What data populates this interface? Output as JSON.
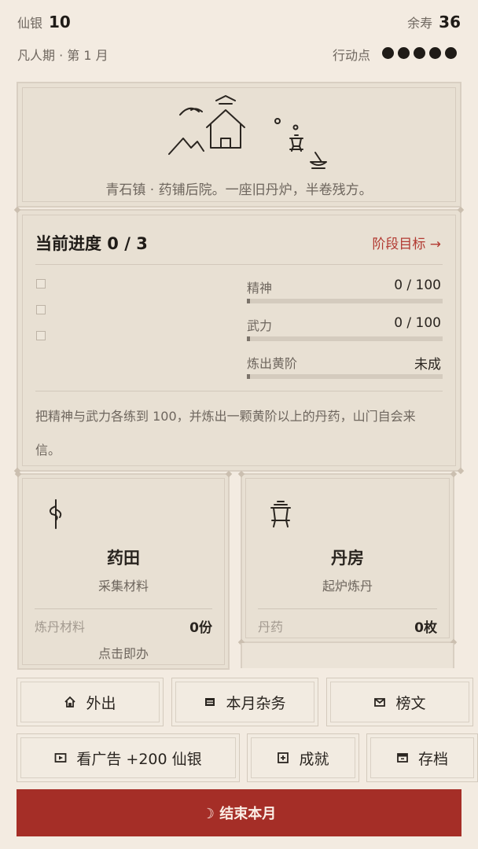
{
  "header": {
    "silver_label": "仙银",
    "silver_value": "10",
    "lifespan_label": "余寿",
    "lifespan_value": "36",
    "stage_text": "凡人期 · 第 1 月",
    "action_label": "行动点",
    "action_points": 5
  },
  "scene": {
    "caption": "青石镇 · 药铺后院。一座旧丹炉，半卷残方。"
  },
  "progress": {
    "title": "当前进度 0 / 3",
    "goal_link": "阶段目标 →",
    "stats": [
      {
        "label": "精神",
        "value": "0 / 100",
        "fraction": 0
      },
      {
        "label": "武力",
        "value": "0 / 100",
        "fraction": 0
      },
      {
        "label": "炼出黄阶",
        "value": "未成",
        "fraction": 0
      }
    ],
    "description": "把精神与武力各练到 100，并炼出一颗黄阶以上的丹药，山门自会来信。"
  },
  "cards": {
    "herb_field": {
      "title": "药田",
      "subtitle": "采集材料",
      "stat_label": "炼丹材料",
      "stat_value": "0份",
      "hint": "点击即办"
    },
    "alchemy_room": {
      "title": "丹房",
      "subtitle": "起炉炼丹",
      "stat_label": "丹药",
      "stat_value": "0枚"
    }
  },
  "actions": {
    "go_out": "外出",
    "monthly_tasks": "本月杂务",
    "notices": "榜文",
    "watch_ad": "看广告 +200 仙银",
    "achievements": "成就",
    "save": "存档",
    "end_month": "☽  结束本月"
  },
  "colors": {
    "background": "#f3ebe1",
    "panel": "#e8e0d3",
    "accent_red": "#a52e27",
    "link_red": "#b23a32"
  }
}
